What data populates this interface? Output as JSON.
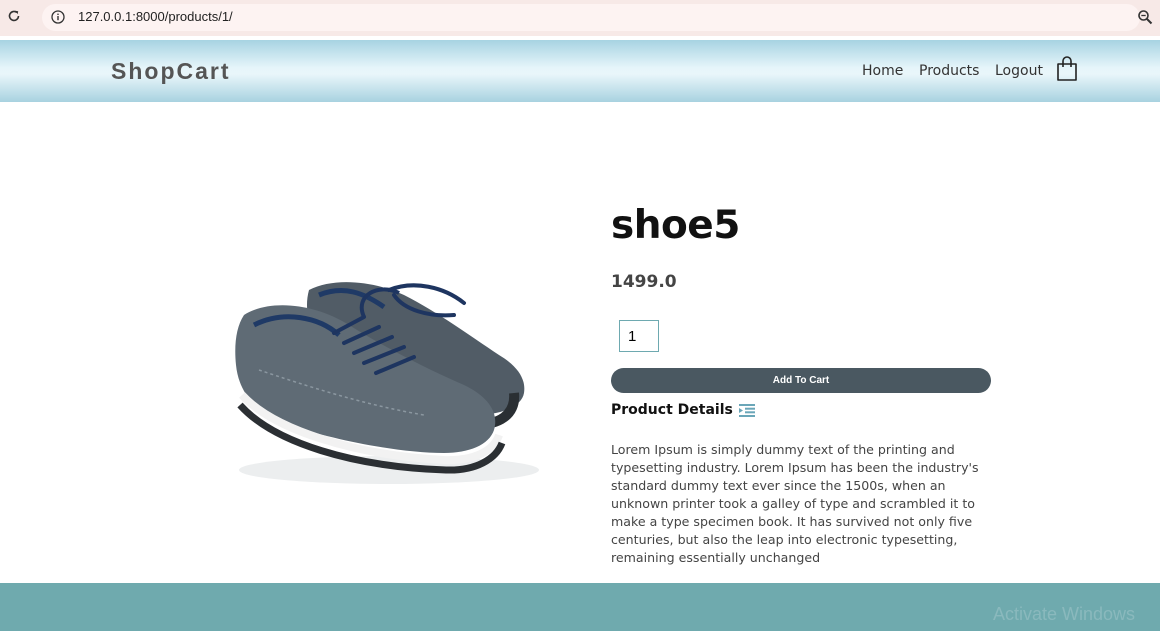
{
  "browser": {
    "url": "127.0.0.1:8000/products/1/",
    "reload_icon": "reload-icon",
    "info_icon": "info-icon",
    "zoom_icon": "zoom-icon"
  },
  "navbar": {
    "brand": "ShopCart",
    "links": [
      "Home",
      "Products",
      "Logout"
    ],
    "cart_icon": "shopping-bag-icon"
  },
  "product": {
    "title": "shoe5",
    "price": "1499.0",
    "quantity": "1",
    "add_to_cart_label": "Add To Cart",
    "details_heading": "Product Details",
    "details_icon": "list-indent-icon",
    "description": "Lorem Ipsum is simply dummy text of the printing and typesetting industry. Lorem Ipsum has been the industry's standard dummy text ever since the 1500s, when an unknown printer took a galley of type and scrambled it to make a type specimen book. It has survived not only five centuries, but also the leap into electronic typesetting, remaining essentially unchanged"
  },
  "watermark": "Activate Windows",
  "colors": {
    "button": "#4a5861",
    "footer": "#6faaae",
    "navbar_edge": "#a7d3e2"
  }
}
